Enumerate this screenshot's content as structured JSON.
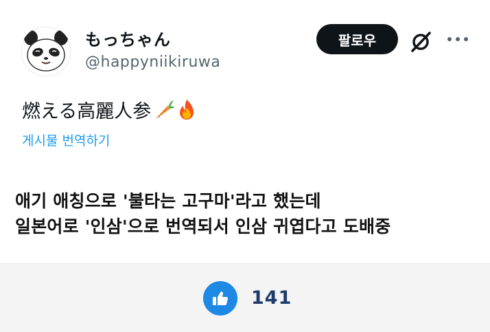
{
  "tweet": {
    "display_name": "もっちゃん",
    "handle": "@happyniikiruwa",
    "follow_label": "팔로우",
    "text": "燃える高麗人参",
    "emojis": [
      "carrot-emoji",
      "fire-emoji"
    ],
    "translate_label": "게시물 번역하기"
  },
  "post": {
    "caption_line1": "애기 애칭으로 '불타는 고구마'라고 했는데",
    "caption_line2": "일본어로 '인삼'으로 번역되서 인삼 귀엽다고 도배중"
  },
  "footer": {
    "like_count": "141"
  },
  "colors": {
    "accent": "#1d9bf0",
    "follow_bg": "#0f1419",
    "like_bg": "#1e88e5",
    "like_count": "#1c3d6b"
  }
}
